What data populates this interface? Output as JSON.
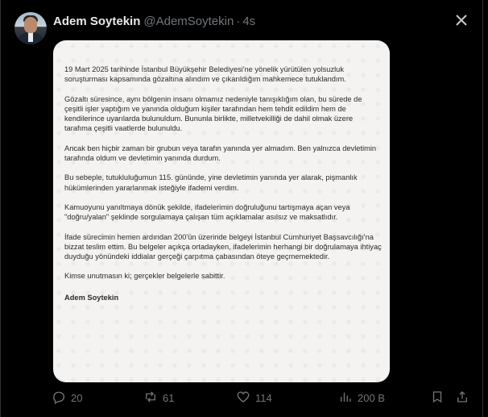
{
  "post": {
    "author_name": "Adem Soytekin",
    "author_handle": "@AdemSoytekin",
    "separator": "·",
    "time": "4s"
  },
  "document": {
    "paragraphs": [
      "19 Mart 2025 tarihinde İstanbul Büyükşehir Belediyesi'ne yönelik yürütülen yolsuzluk soruşturması kapsamında gözaltına alındım ve çıkarıldığım mahkemece tutuklandım.",
      "Gözaltı süresince, aynı bölgenin insanı olmamız nedeniyle tanışıklığım olan, bu sürede de çeşitli işler yaptığım ve yanında olduğum kişiler tarafından hem tehdit edildim hem de kendilerince uyarılarda bulunuldum. Bununla birlikte, milletvekilliği de dahil olmak üzere tarafıma çeşitli vaatlerde bulunuldu.",
      "Ancak ben hiçbir zaman bir grubun veya tarafın yanında yer almadım. Ben yalnızca devletimin tarafında oldum ve devletimin yanında durdum.",
      "Bu sebeple, tutukluluğumun 115. gününde, yine devletimin yanında yer alarak, pişmanlık hükümlerinden yararlanmak isteğiyle ifademi verdim.",
      "Kamuoyunu yanıltmaya dönük şekilde, ifadelerimin doğruluğunu tartışmaya açan veya \"doğru/yalan\" şeklinde sorgulamaya çalışan tüm açıklamalar asılsız ve maksatlıdır.",
      "İfade sürecimin hemen ardından 200'ün üzerinde belgeyi İstanbul Cumhuriyet Başsavcılığı'na bizzat teslim ettim. Bu belgeler açıkça ortadayken, ifadelerimin herhangi bir doğrulamaya ihtiyaç duyduğu yönündeki iddialar gerçeği çarpıtma çabasından öteye geçmemektedir.",
      "Kimse unutmasın ki; gerçekler belgelerle sabittir."
    ],
    "signature": "Adem Soytekin"
  },
  "actions": {
    "reply_count": "20",
    "repost_count": "61",
    "like_count": "114",
    "views_count": "200 B"
  },
  "icons": {
    "close": "close-icon",
    "reply": "reply-icon",
    "repost": "repost-icon",
    "like": "heart-icon",
    "views": "views-icon",
    "bookmark": "bookmark-icon",
    "share": "share-icon"
  },
  "colors": {
    "background": "#000000",
    "text_primary": "#e7e9ea",
    "text_secondary": "#71767b",
    "document_bg": "#f4f3f1"
  }
}
